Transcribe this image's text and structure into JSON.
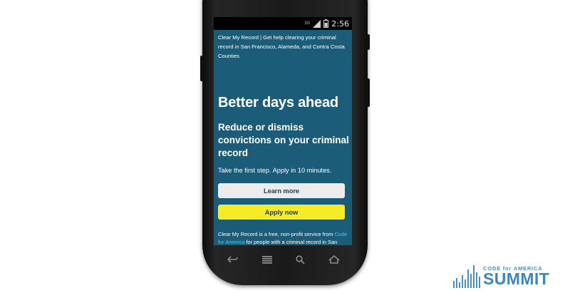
{
  "status_bar": {
    "network": "3G",
    "time": "2:56",
    "icons": [
      "network-3g-icon",
      "signal-icon",
      "battery-icon"
    ]
  },
  "site": {
    "header": "Clear My Record | Get help clearing your criminal record in San Francisco, Alameda, and Contra Costa Counties",
    "hero_title": "Better days ahead",
    "hero_subtitle": "Reduce or dismiss convictions on your criminal record",
    "tagline": "Take the first step. Apply in 10 minutes.",
    "learn_more": "Learn more",
    "apply_now": "Apply now",
    "about_before": "Clear My Record is a free, non-profit service from ",
    "about_link": "Code for America",
    "about_after": " for people with a criminal record in San Francisco, Alameda, and Contra Costa Counties. We are not a law firm and the information on this site is not legal advice."
  },
  "nav_bar": {
    "icons": [
      "back-icon",
      "menu-icon",
      "search-icon",
      "home-icon"
    ]
  },
  "logo": {
    "small_text": "CODE for AMERICA",
    "big_text": "SUMMIT"
  },
  "colors": {
    "screen_background": "#1b5d78",
    "apply_button": "#f5eb27",
    "learn_button": "#ececec",
    "link": "#52c5f0",
    "logo_blue": "#3b86c0"
  }
}
